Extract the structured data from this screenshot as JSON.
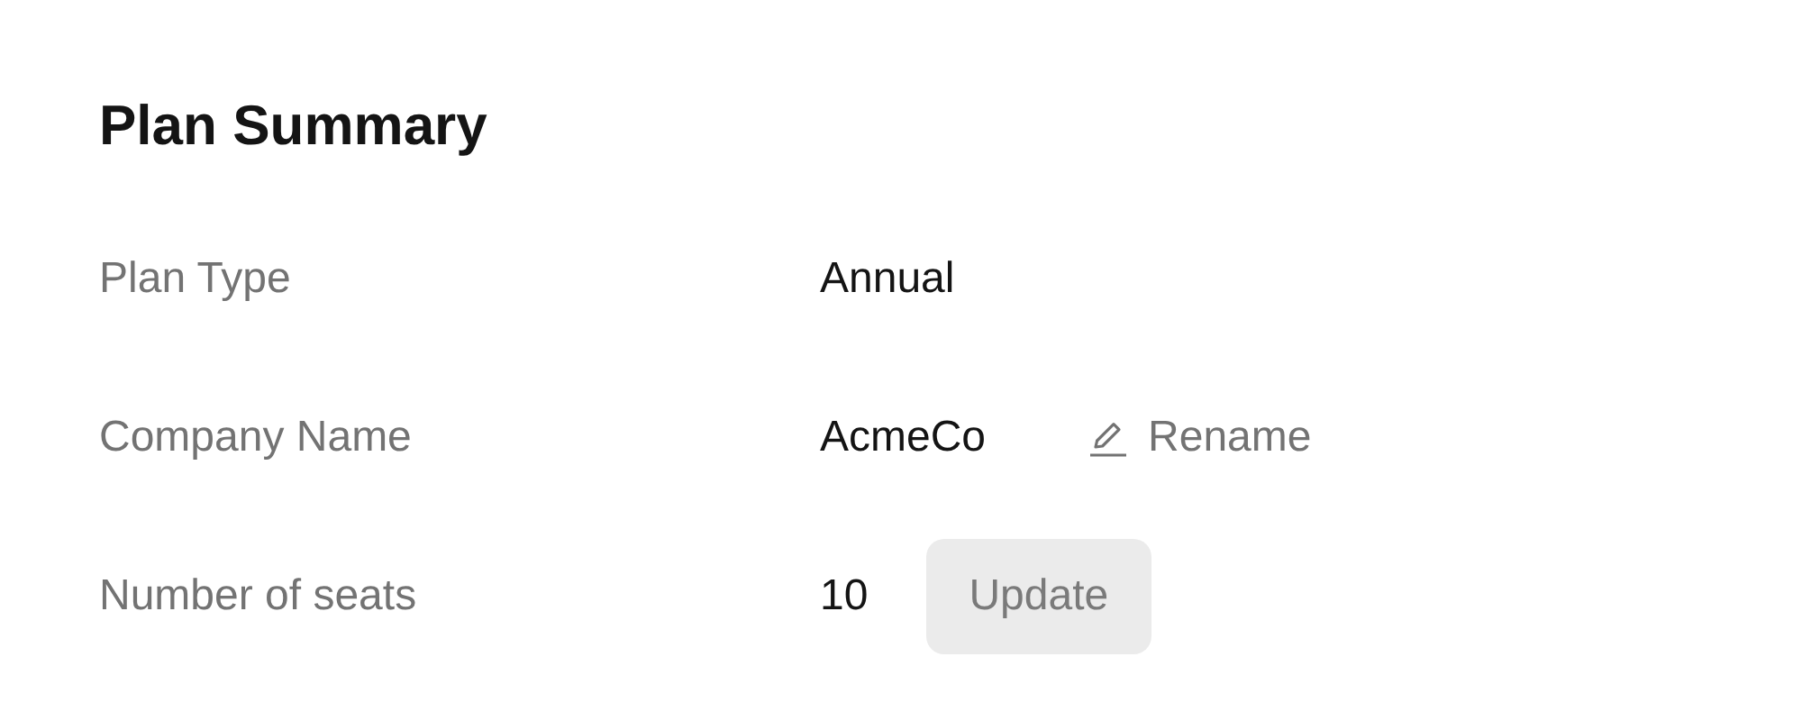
{
  "title": "Plan Summary",
  "rows": [
    {
      "label": "Plan Type",
      "value": "Annual"
    },
    {
      "label": "Company Name",
      "value": "AcmeCo",
      "action": {
        "kind": "link",
        "label": "Rename"
      }
    },
    {
      "label": "Number of seats",
      "value": "10",
      "action": {
        "kind": "button",
        "label": "Update",
        "disabled": true
      }
    }
  ]
}
